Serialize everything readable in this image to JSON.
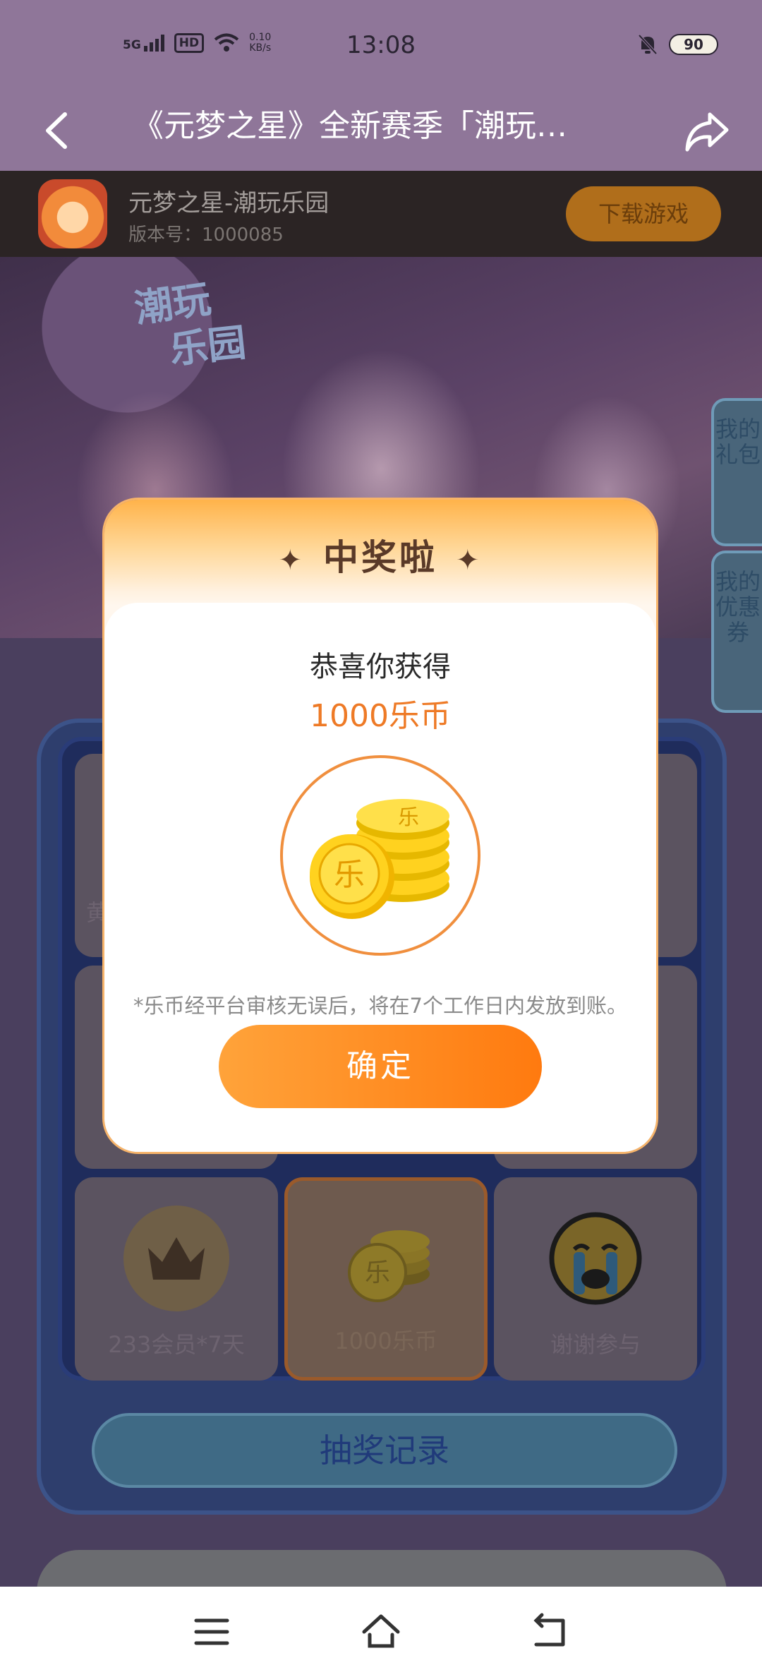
{
  "status_bar": {
    "network": "5G",
    "hd": "HD",
    "speed_value": "0.10",
    "speed_unit": "KB/s",
    "time": "13:08",
    "battery": "90"
  },
  "title_bar": {
    "title": "《元梦之星》全新赛季「潮玩…"
  },
  "game_bar": {
    "name": "元梦之星-潮玩乐园",
    "version": "版本号：1000085",
    "download_label": "下载游戏"
  },
  "banner": {
    "logo_line1": "潮玩",
    "logo_line2": "乐园"
  },
  "side_tabs": {
    "gifts": "我的礼包",
    "coupons": "我的优惠券"
  },
  "lottery": {
    "partial_label": "黄",
    "cells_bottom": [
      {
        "label": "233会员*7天",
        "icon": "crown-icon"
      },
      {
        "label": "1000乐币",
        "icon": "coin-icon"
      },
      {
        "label": "谢谢参与",
        "icon": "crying-face-icon"
      }
    ],
    "record_label": "抽奖记录"
  },
  "dialog": {
    "title": "中奖啦",
    "congrats": "恭喜你获得",
    "prize": "1000乐币",
    "coin_char": "乐",
    "notice": "*乐币经平台审核无误后，将在7个工作日内发放到账。",
    "confirm_label": "确定"
  },
  "colors": {
    "accent_orange": "#ff8a1f",
    "title_bar": "#8f7699",
    "lottery_blue": "#2e3e6d"
  }
}
